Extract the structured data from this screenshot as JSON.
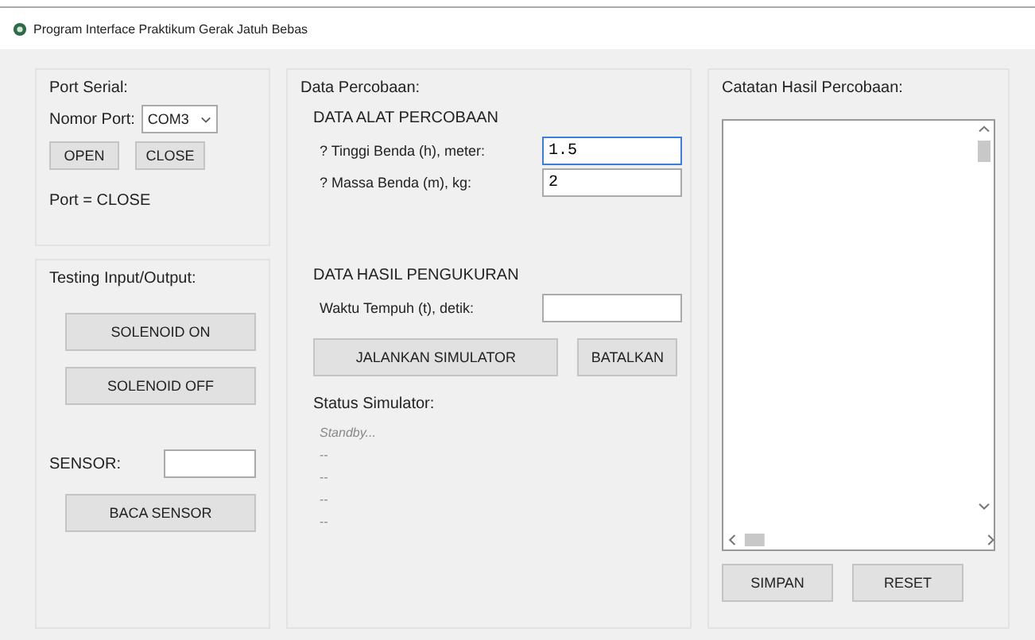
{
  "window": {
    "title": "Program Interface Praktikum Gerak Jatuh Bebas"
  },
  "port_serial": {
    "title": "Port Serial:",
    "port_label": "Nomor Port:",
    "port_value": "COM3",
    "buttons": [
      "OPEN",
      "CLOSE"
    ],
    "status": "Port = CLOSE"
  },
  "testing": {
    "title": "Testing Input/Output:",
    "buttons": [
      "SOLENOID ON",
      "SOLENOID OFF"
    ],
    "sensor_label": "SENSOR:",
    "read_button": "BACA SENSOR"
  },
  "data": {
    "title": "Data Percobaan:",
    "section_1": "DATA ALAT PERCOBAAN",
    "inputs": [
      {
        "label": "? Tinggi Benda (h), meter:",
        "value": "1.5",
        "focused": true
      },
      {
        "label": "? Massa Benda (m), kg:",
        "value": "2",
        "focused": false
      }
    ],
    "section_2": "DATA HASIL PENGUKURAN",
    "time_label": "Waktu Tempuh (t), detik:",
    "buttons": [
      "JALANKAN SIMULATOR",
      "BATALKAN"
    ],
    "status_title": "Status Simulator:",
    "status_lines": [
      "Standby...",
      "--",
      "--",
      "--",
      "--"
    ]
  },
  "log": {
    "title": "Catatan Hasil Percobaan:",
    "buttons": [
      "SIMPAN",
      "RESET"
    ]
  }
}
